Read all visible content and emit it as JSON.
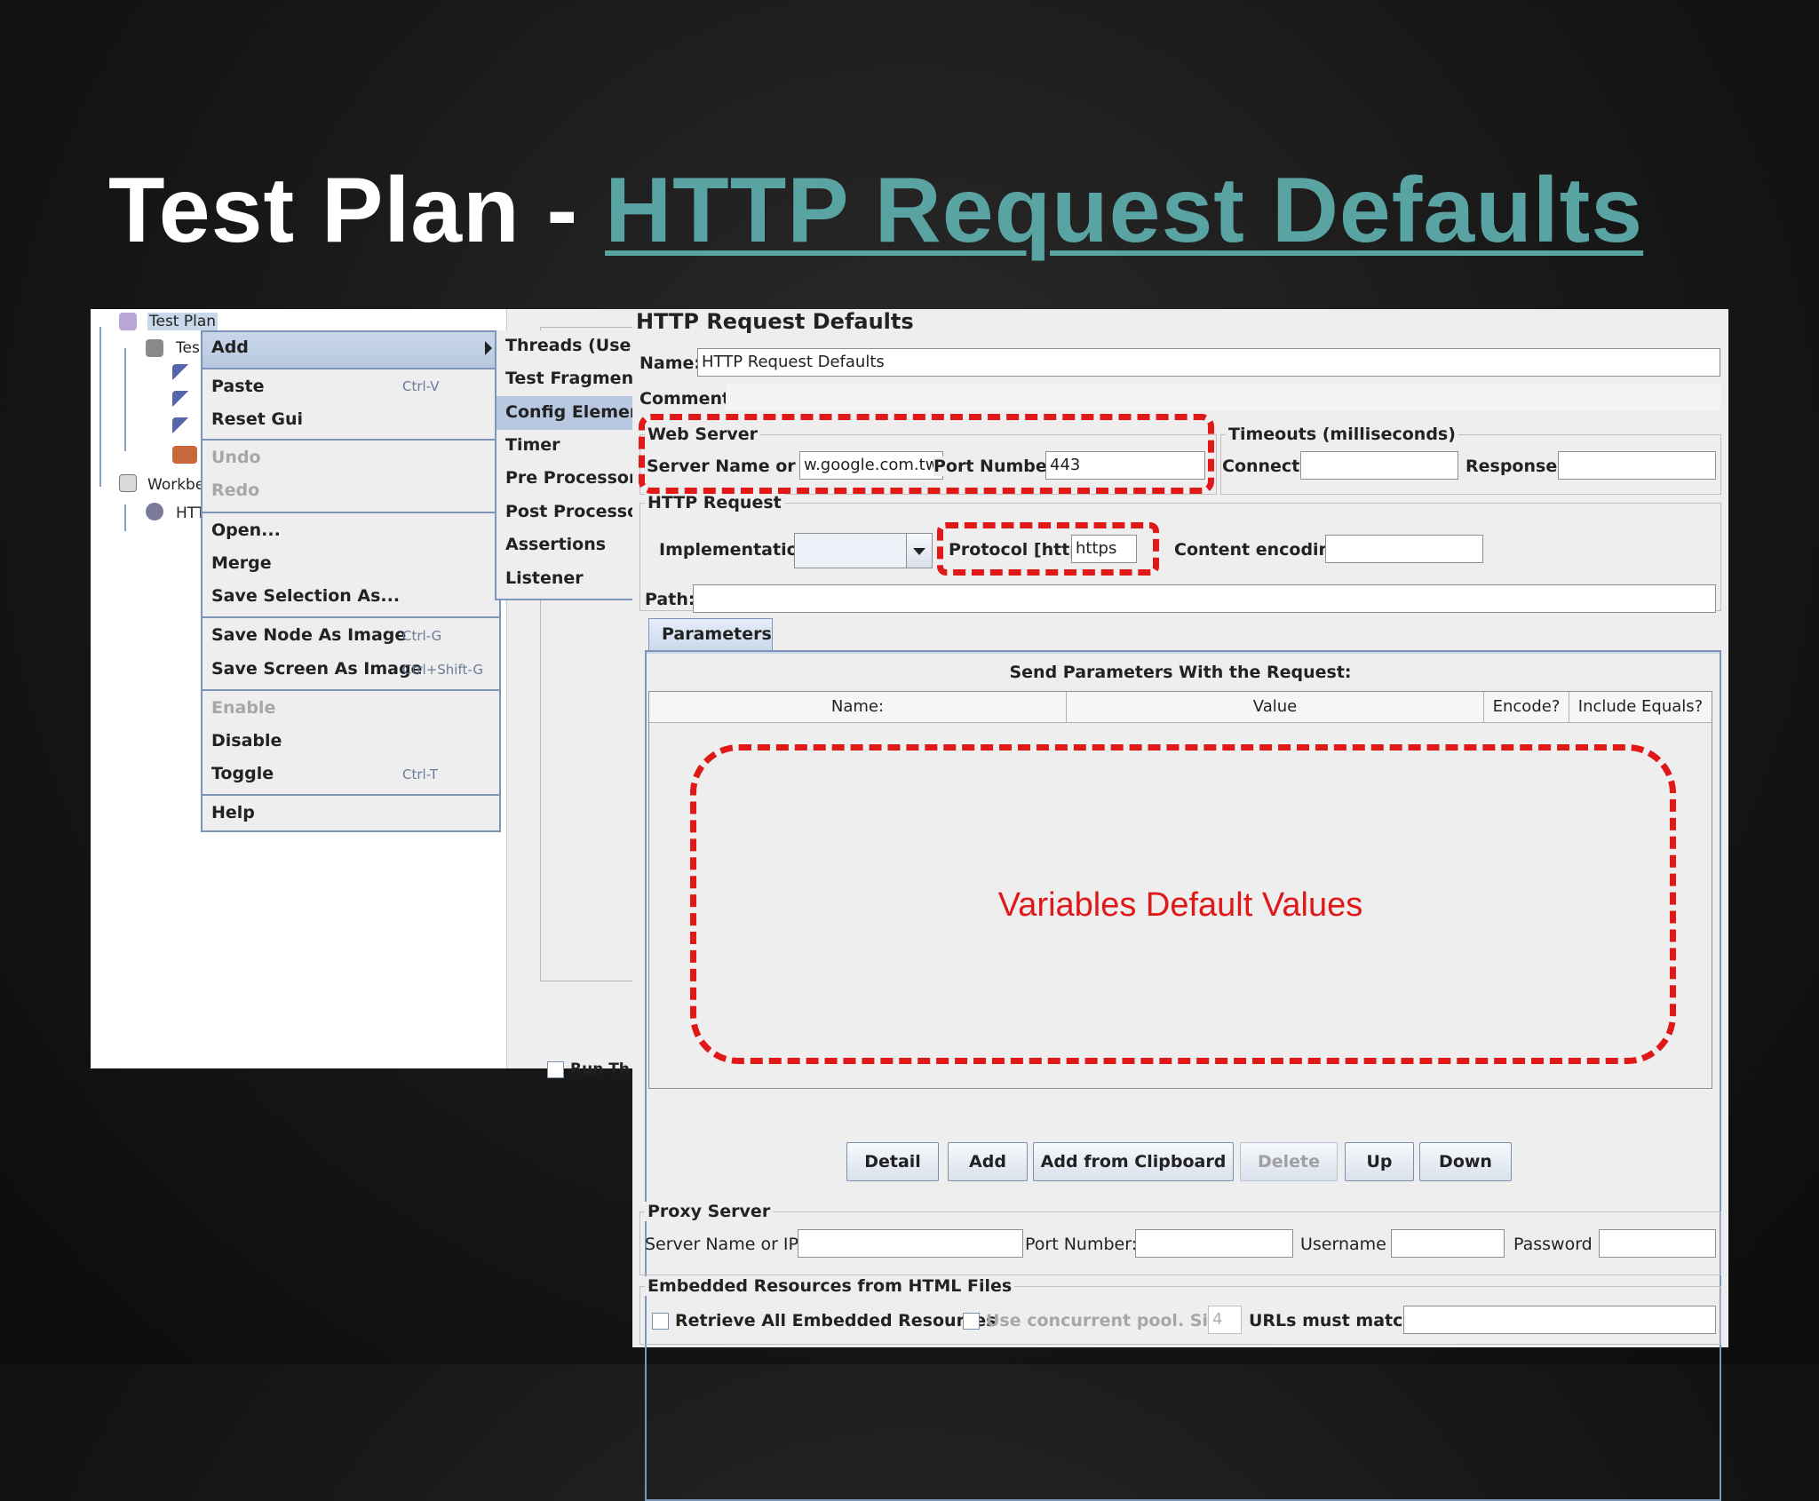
{
  "slide": {
    "title_prefix": "Test Plan - ",
    "title_link": "HTTP Request Defaults"
  },
  "tree": {
    "items": [
      {
        "label": "Test Plan",
        "icon": "flask-icon"
      },
      {
        "label": "Tes",
        "icon": "thread-group-icon"
      },
      {
        "label": "",
        "icon": "sampler-icon"
      },
      {
        "label": "",
        "icon": "sampler-icon"
      },
      {
        "label": "",
        "icon": "sampler-icon"
      },
      {
        "label": "",
        "icon": "listener-icon"
      },
      {
        "label": "Workbe",
        "icon": "workbench-icon"
      },
      {
        "label": "HTT",
        "icon": "gear-icon"
      }
    ],
    "run_label": "Run Th"
  },
  "context_menu": {
    "add": "Add",
    "paste": "Paste",
    "paste_sc": "Ctrl-V",
    "reset_gui": "Reset Gui",
    "undo": "Undo",
    "redo": "Redo",
    "open": "Open...",
    "merge": "Merge",
    "save_selection": "Save Selection As...",
    "save_node_image": "Save Node As Image",
    "save_node_image_sc": "Ctrl-G",
    "save_screen_image": "Save Screen As Image",
    "save_screen_image_sc": "Ctrl+Shift-G",
    "enable": "Enable",
    "disable": "Disable",
    "toggle": "Toggle",
    "toggle_sc": "Ctrl-T",
    "help": "Help"
  },
  "submenu": {
    "items": [
      "Threads (Users",
      "Test Fragment",
      "Config Element",
      "Timer",
      "Pre Processors",
      "Post Processor",
      "Assertions",
      "Listener"
    ],
    "selected": "Config Element"
  },
  "panel": {
    "title": "HTTP Request Defaults",
    "name_label": "Name:",
    "name_value": "HTTP Request Defaults",
    "comments_label": "Comments:",
    "web_server": {
      "title": "Web Server",
      "server_label": "Server Name or IP:",
      "server_value": "w.google.com.tw",
      "port_label": "Port Number:",
      "port_value": "443"
    },
    "timeouts": {
      "title": "Timeouts (milliseconds)",
      "connect_label": "Connect:",
      "connect_value": "",
      "response_label": "Response:",
      "response_value": ""
    },
    "http_request": {
      "title": "HTTP Request",
      "implementation_label": "Implementation:",
      "implementation_value": "",
      "protocol_label": "Protocol [http]:",
      "protocol_value": "https",
      "encoding_label": "Content encoding:",
      "encoding_value": "",
      "path_label": "Path:",
      "path_value": ""
    },
    "params": {
      "tab": "Parameters",
      "heading": "Send Parameters With the Request:",
      "columns": [
        "Name:",
        "Value",
        "Encode?",
        "Include Equals?"
      ],
      "annotation": "Variables Default Values"
    },
    "buttons": {
      "detail": "Detail",
      "add": "Add",
      "add_clipboard": "Add from Clipboard",
      "delete": "Delete",
      "up": "Up",
      "down": "Down"
    },
    "proxy": {
      "title": "Proxy Server",
      "server_label": "Server Name or IP:",
      "port_label": "Port Number:",
      "username_label": "Username",
      "password_label": "Password"
    },
    "embedded": {
      "title": "Embedded Resources from HTML Files",
      "retrieve_label": "Retrieve All Embedded Resources",
      "concurrent_label": "Use concurrent pool. Size:",
      "pool_size": "4",
      "urls_label": "URLs must match:",
      "urls_value": ""
    }
  },
  "colors": {
    "title_link": "#5aa3a3",
    "annotation": "#e01818",
    "menu_highlight": "#b7c8e0"
  }
}
